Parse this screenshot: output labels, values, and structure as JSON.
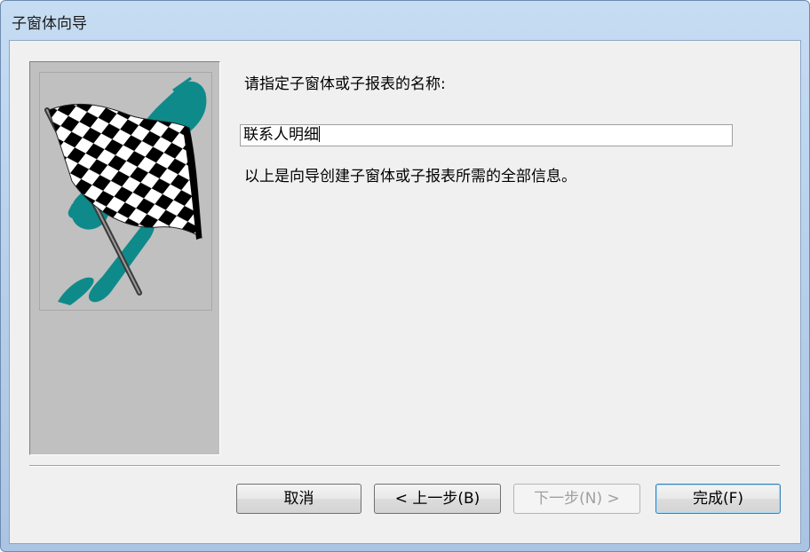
{
  "window": {
    "title": "子窗体向导"
  },
  "main": {
    "prompt": "请指定子窗体或子报表的名称:",
    "name_value": "联系人明细",
    "info": "以上是向导创建子窗体或子报表所需的全部信息。"
  },
  "buttons": {
    "cancel": "取消",
    "back": "< 上一步(B)",
    "next": "下一步(N) >",
    "finish": "完成(F)"
  },
  "colors": {
    "flag_teal": "#0f8a8a",
    "panel_gray": "#c0c0c0",
    "title_bar": "#c6dcf3"
  },
  "icons": {
    "side_graphic": "checkered-flag-icon"
  }
}
